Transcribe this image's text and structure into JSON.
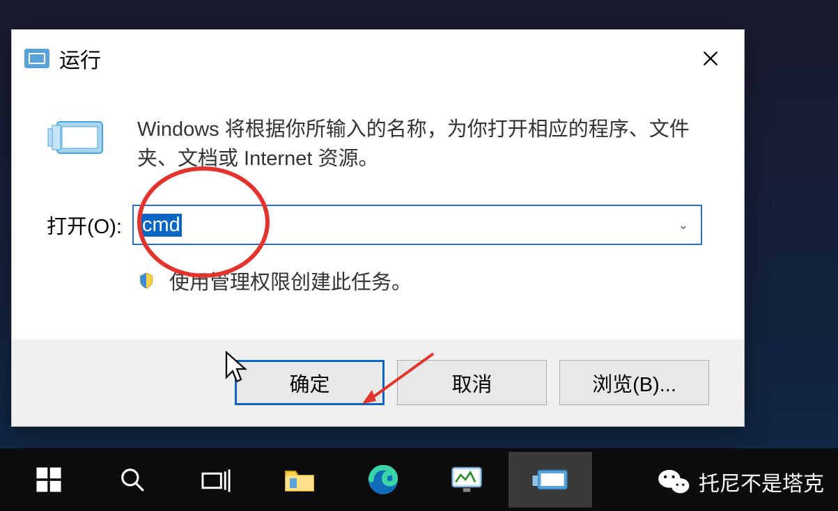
{
  "dialog": {
    "title": "运行",
    "description": "Windows 将根据你所输入的名称，为你打开相应的程序、文件夹、文档或 Internet 资源。",
    "open_label": "打开(O):",
    "input_value": "cmd",
    "admin_note": "使用管理权限创建此任务。",
    "buttons": {
      "ok": "确定",
      "cancel": "取消",
      "browse": "浏览(B)..."
    }
  },
  "taskbar": {
    "items": [
      "start",
      "search",
      "task-view",
      "file-explorer",
      "edge",
      "monitor",
      "run"
    ]
  },
  "watermark": {
    "text": "托尼不是塔克"
  }
}
